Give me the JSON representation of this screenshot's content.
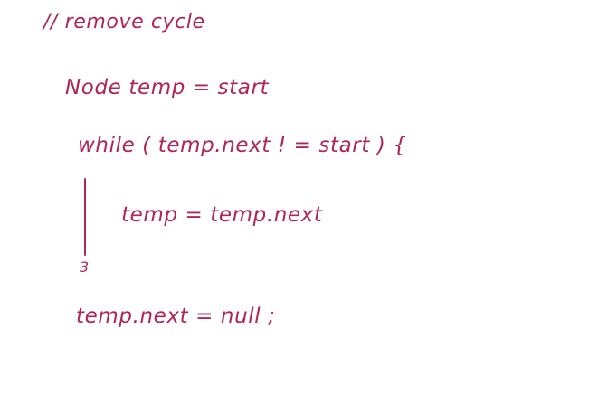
{
  "colors": {
    "ink": "#b0245a",
    "background": "#ffffff"
  },
  "note": {
    "line1": "// remove cycle",
    "line2": "Node temp = start",
    "line3": "while ( temp.next ! = start ) {",
    "line4": "temp = temp.next",
    "line5": "3",
    "line6": "temp.next = null ;"
  }
}
